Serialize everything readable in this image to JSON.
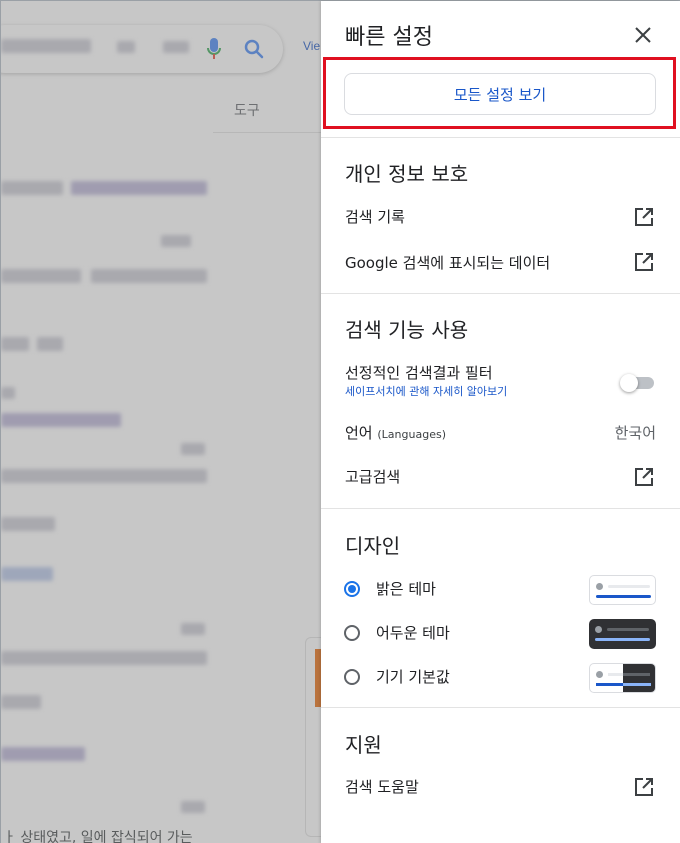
{
  "background": {
    "view_link": "Vie",
    "tools_label": "도구",
    "bottom_snippet": "ㅏ 상태였고, 일에 잡식되어 가는"
  },
  "panel": {
    "title": "빠른 설정",
    "close_icon": "close-icon",
    "all_settings_label": "모든 설정 보기",
    "privacy": {
      "title": "개인 정보 보호",
      "search_history": "검색 기록",
      "your_data": "Google 검색에 표시되는 데이터"
    },
    "search_features": {
      "title": "검색 기능 사용",
      "explicit_filter": "선정적인 검색결과 필터",
      "safesearch_link": "세이프서치에 관해 자세히 알아보기",
      "safesearch_on": false,
      "language_label": "언어",
      "language_note": "(Languages)",
      "language_value": "한국어",
      "advanced_search": "고급검색"
    },
    "design": {
      "title": "디자인",
      "themes": [
        {
          "label": "밝은 테마",
          "checked": true
        },
        {
          "label": "어두운 테마",
          "checked": false
        },
        {
          "label": "기기 기본값",
          "checked": false
        }
      ]
    },
    "support": {
      "title": "지원",
      "search_help": "검색 도움말"
    }
  },
  "colors": {
    "accent": "#1a57c9",
    "highlight": "#e01020",
    "radio_checked": "#1a73e8"
  }
}
